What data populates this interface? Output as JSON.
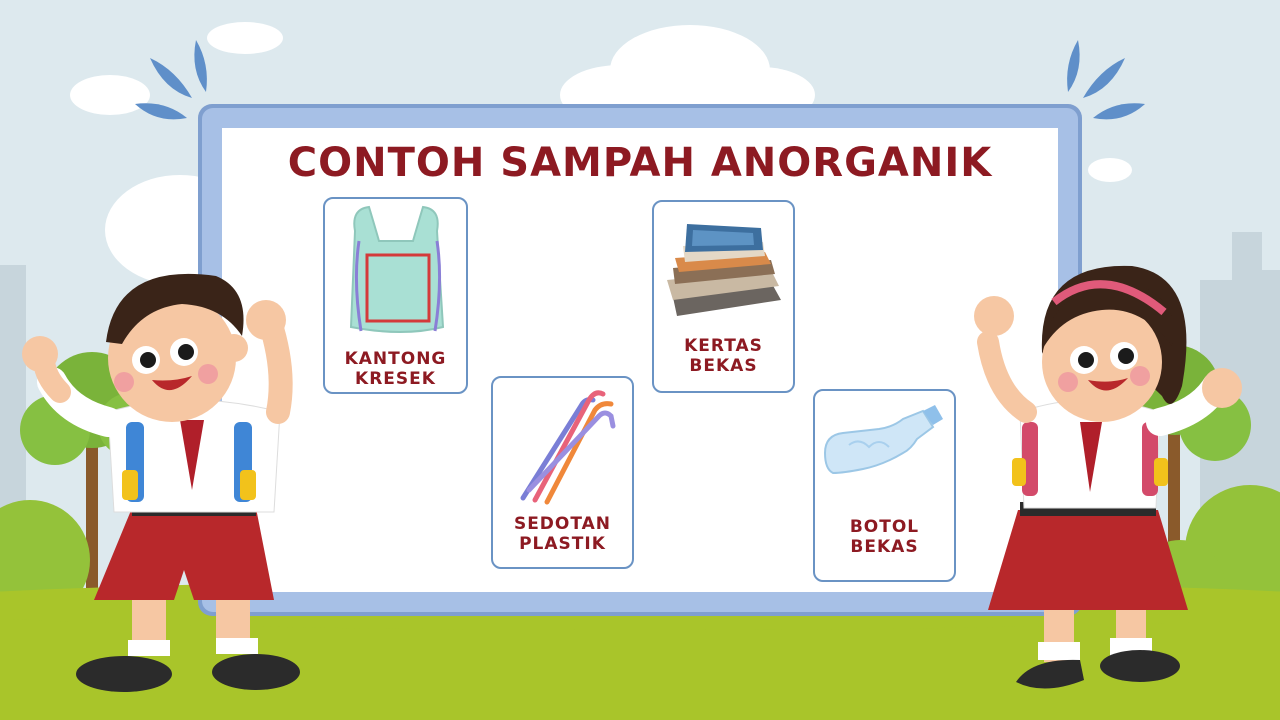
{
  "title": "CONTOH SAMPAH ANORGANIK",
  "items": [
    {
      "label": "KANTONG\nKRESEK",
      "icon": "plastic-bag-icon"
    },
    {
      "label": "KERTAS\nBEKAS",
      "icon": "paper-stack-icon"
    },
    {
      "label": "SEDOTAN\nPLASTIK",
      "icon": "straws-icon"
    },
    {
      "label": "BOTOL\nBEKAS",
      "icon": "bottle-icon"
    }
  ],
  "colors": {
    "title": "#8d1a22",
    "frame": "#7f9fcf",
    "card_border": "#6a93c4",
    "sky": "#dde9ee",
    "grass": "#a9c52a"
  }
}
